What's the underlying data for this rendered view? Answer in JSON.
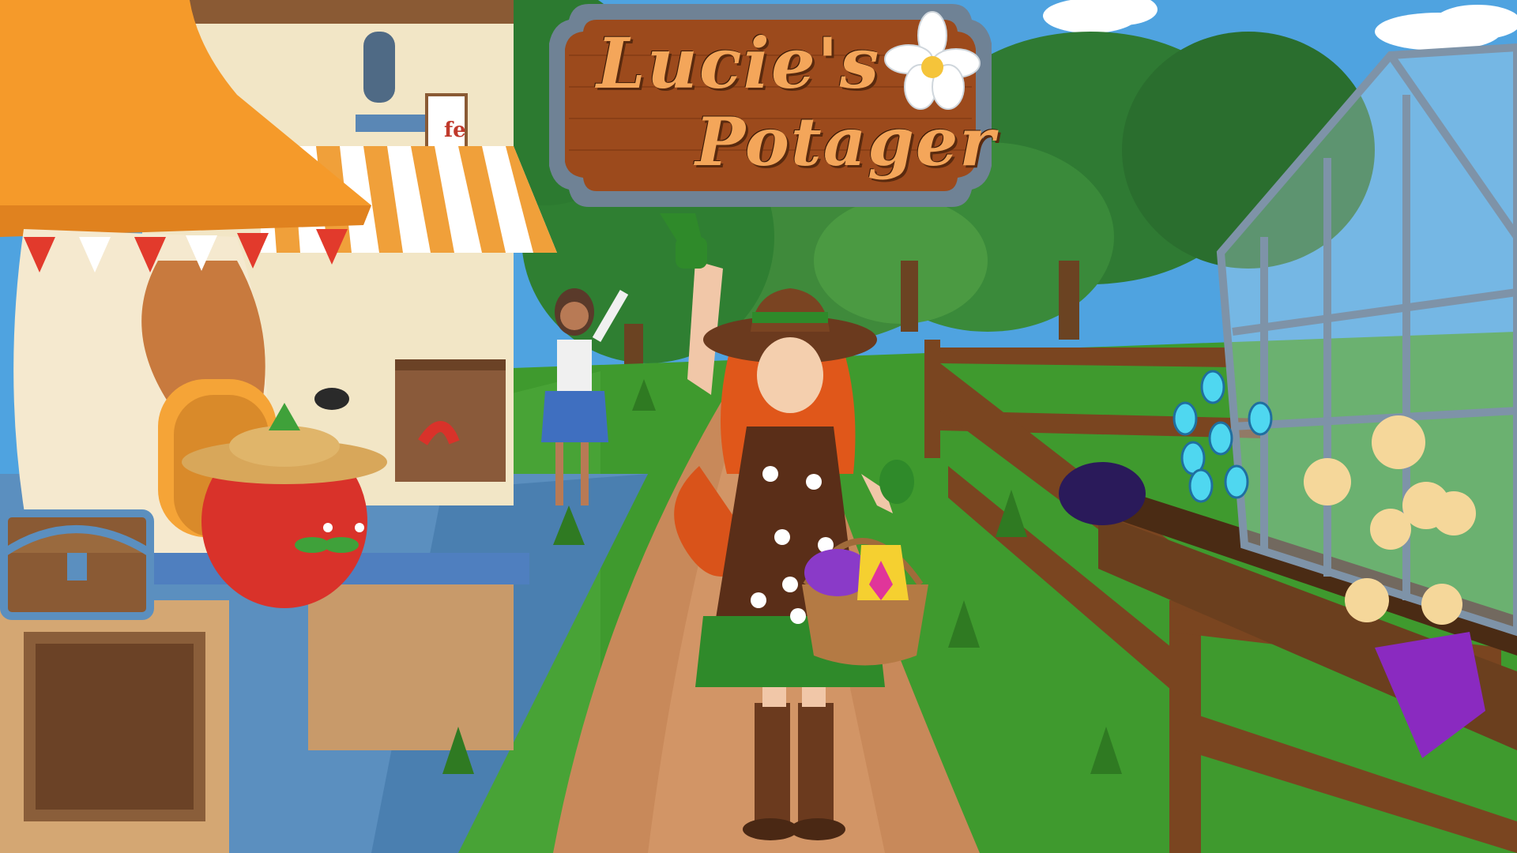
{
  "game": {
    "title_line1": "Lucie's",
    "title_line2": "Potager"
  },
  "shop_sign_fragment": "fe",
  "colors": {
    "sky": "#4fa3e0",
    "grass": "#3f9a2e",
    "path": "#c8895a",
    "sign_wood": "#9c4a1c",
    "sign_frame": "#6f8295",
    "awning_orange": "#f59a2a",
    "fence_wood": "#7a4520"
  },
  "icons": {
    "sign_flower": "white-lily-icon",
    "chest": "treasure-chest-icon",
    "basket": "basket-icon"
  }
}
